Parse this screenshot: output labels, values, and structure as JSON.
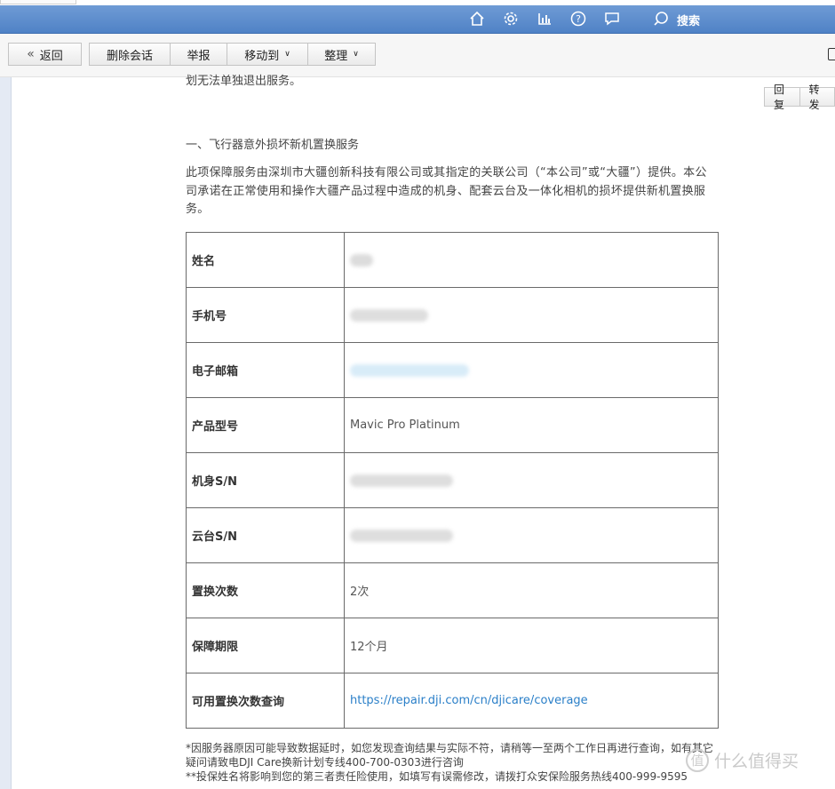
{
  "topbar": {
    "icons": [
      "home-icon",
      "gear-icon",
      "chart-icon",
      "help-icon",
      "feedback-icon",
      "search-icon"
    ],
    "search_label": "搜索",
    "accent": "#5a8ccc"
  },
  "toolbar": {
    "back_label": "返回",
    "delete_label": "删除会话",
    "report_label": "举报",
    "move_label": "移动到",
    "organize_label": "整理"
  },
  "reply_buttons": {
    "reply": "回复",
    "forward": "转发"
  },
  "email": {
    "cut_line": "划无法单独退出服务。",
    "section_title": "一、飞行器意外损坏新机置换服务",
    "intro": "此项保障服务由深圳市大疆创新科技有限公司或其指定的关联公司（“本公司”或“大疆”）提供。本公司承诺在正常使用和操作大疆产品过程中造成的机身、配套云台及一体化相机的损坏提供新机置换服务。",
    "rows": [
      {
        "label": "姓名",
        "value": ""
      },
      {
        "label": "手机号",
        "value": ""
      },
      {
        "label": "电子邮箱",
        "value": ""
      },
      {
        "label": "产品型号",
        "value": "Mavic Pro Platinum"
      },
      {
        "label": "机身S/N",
        "value": ""
      },
      {
        "label": "云台S/N",
        "value": ""
      },
      {
        "label": "置换次数",
        "value": "2次"
      },
      {
        "label": "保障期限",
        "value": "12个月"
      },
      {
        "label": "可用置换次数查询",
        "value": "https://repair.dji.com/cn/djicare/coverage"
      }
    ],
    "footnote_1": "*因服务器原因可能导致数据延时，如您发现查询结果与实际不符，请稍等一至两个工作日再进行查询，如有其它疑问请致电DJI Care换新计划专线400-700-0303进行咨询",
    "footnote_2": "**投保姓名将影响到您的第三者责任险使用，如填写有误需修改，请拨打众安保险服务热线400-999-9595"
  },
  "watermark": {
    "symbol": "值",
    "text": "什么值得买"
  }
}
